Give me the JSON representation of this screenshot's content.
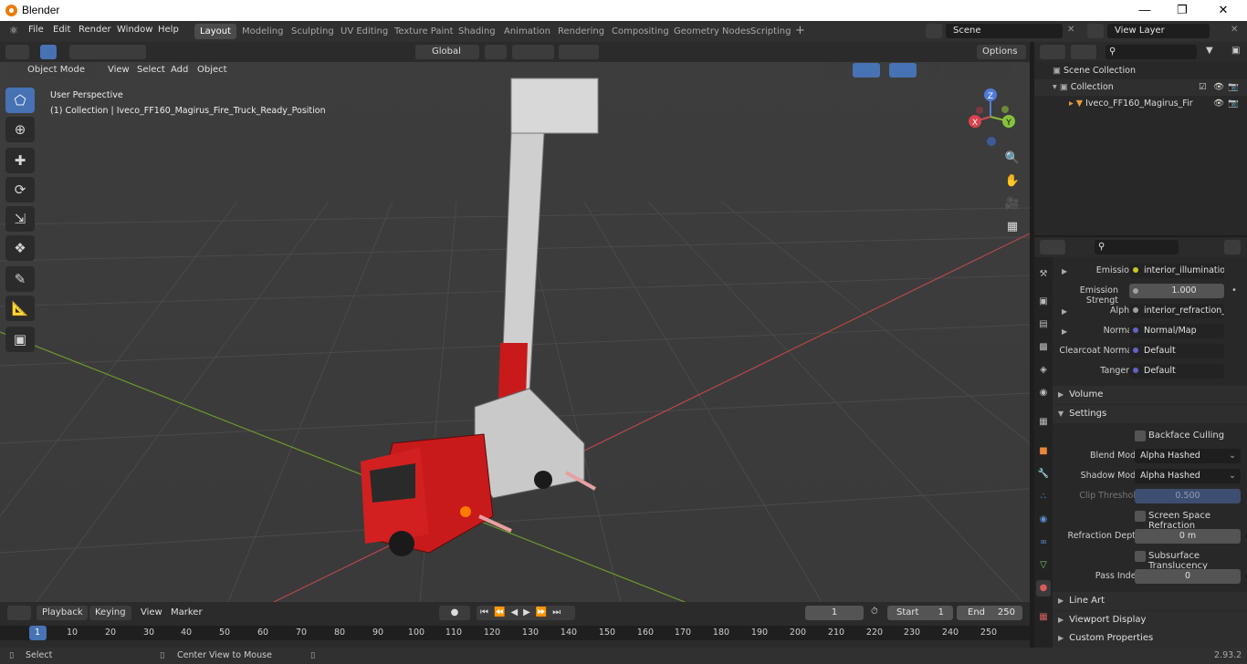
{
  "window": {
    "title": "Blender"
  },
  "menus": [
    "File",
    "Edit",
    "Render",
    "Window",
    "Help"
  ],
  "workspaces": [
    "Layout",
    "Modeling",
    "Sculpting",
    "UV Editing",
    "Texture Paint",
    "Shading",
    "Animation",
    "Rendering",
    "Compositing",
    "Geometry Nodes",
    "Scripting"
  ],
  "scene": {
    "name": "Scene",
    "view_layer": "View Layer"
  },
  "viewport": {
    "mode": "Object Mode",
    "menus": [
      "View",
      "Select",
      "Add",
      "Object"
    ],
    "orientation": "Global",
    "options": "Options",
    "perspective": "User Perspective",
    "collection_info": "(1) Collection | Iveco_FF160_Magirus_Fire_Truck_Ready_Position",
    "gizmo": {
      "z": "Z",
      "x": "X",
      "y": "Y"
    }
  },
  "outliner": {
    "rows": [
      {
        "label": "Scene Collection"
      },
      {
        "label": "Collection"
      },
      {
        "label": "Iveco_FF160_Magirus_Fir"
      }
    ]
  },
  "properties": {
    "inputs": [
      {
        "label": "Emission",
        "value": "interior_illumination...",
        "dot": "#c7c729",
        "arrow": true
      },
      {
        "label": "Emission Strengt",
        "value": "1.000",
        "dot": "#a0a0a0",
        "numeric": true
      },
      {
        "label": "Alpha",
        "value": "interior_refraction_in...",
        "dot": "#a0a0a0",
        "arrow": true
      },
      {
        "label": "Normal",
        "value": "Normal/Map",
        "dot": "#6363c7",
        "arrow": true
      },
      {
        "label": "Clearcoat Normal",
        "value": "Default",
        "dot": "#6363c7"
      },
      {
        "label": "Tangent",
        "value": "Default",
        "dot": "#6363c7"
      }
    ],
    "panels": {
      "volume": "Volume",
      "settings": "Settings",
      "line_art": "Line Art",
      "viewport_display": "Viewport Display",
      "custom_properties": "Custom Properties"
    },
    "settings": {
      "backface_culling": "Backface Culling",
      "blend_mode_label": "Blend Mode",
      "blend_mode": "Alpha Hashed",
      "shadow_mode_label": "Shadow Mode",
      "shadow_mode": "Alpha Hashed",
      "clip_threshold_label": "Clip Threshold",
      "clip_threshold": "0.500",
      "ssr": "Screen Space Refraction",
      "refraction_depth_label": "Refraction Depth",
      "refraction_depth": "0 m",
      "subsurface": "Subsurface Translucency",
      "pass_index_label": "Pass Index",
      "pass_index": "0"
    }
  },
  "timeline": {
    "menus": [
      "Playback",
      "Keying",
      "View",
      "Marker"
    ],
    "current_frame": "1",
    "start_label": "Start",
    "start": "1",
    "end_label": "End",
    "end": "250",
    "ticks": [
      "1",
      "10",
      "20",
      "30",
      "40",
      "50",
      "60",
      "70",
      "80",
      "90",
      "100",
      "110",
      "120",
      "130",
      "140",
      "150",
      "160",
      "170",
      "180",
      "190",
      "200",
      "210",
      "220",
      "230",
      "240",
      "250"
    ]
  },
  "status": {
    "select": "Select",
    "center_view": "Center View to Mouse",
    "version": "2.93.2"
  },
  "colors": {
    "accent": "#4772b3",
    "axis_x": "#b8464c",
    "axis_y": "#6e9a2a",
    "truck_red": "#c81a1a"
  }
}
